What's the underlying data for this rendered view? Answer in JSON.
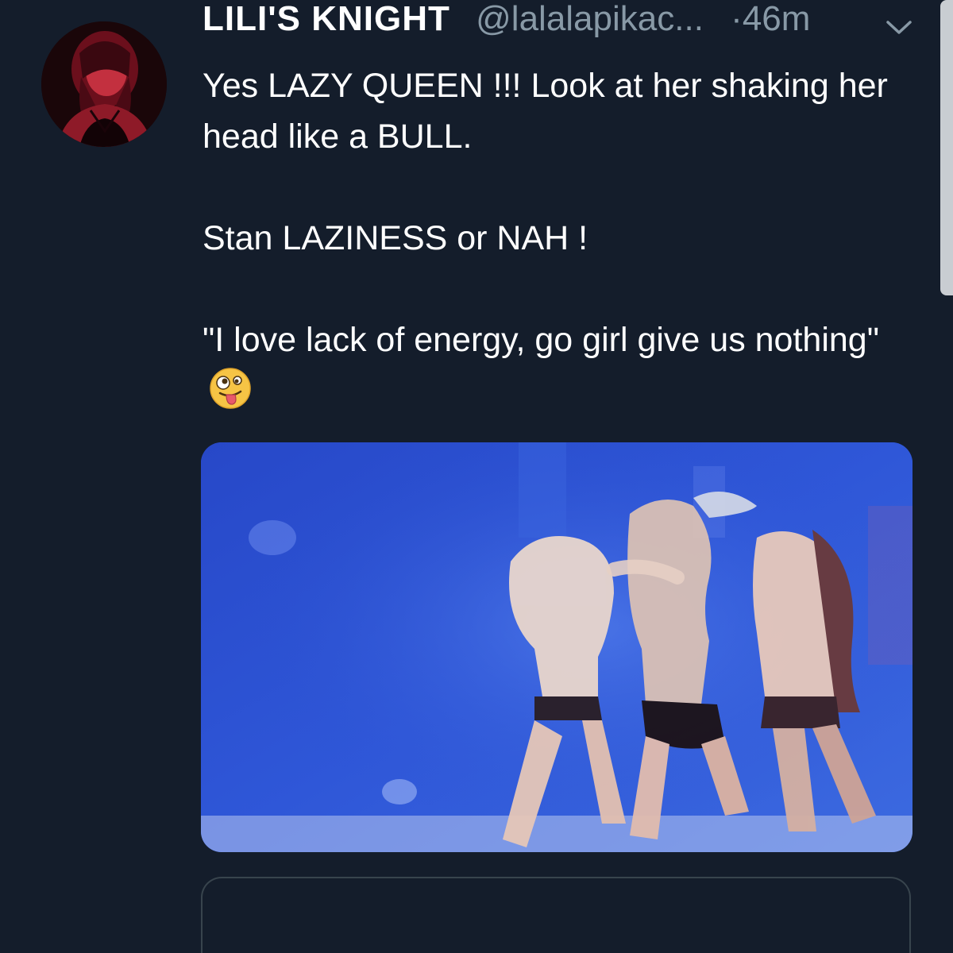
{
  "tweet": {
    "author": {
      "display_name": "LILI'S KNIGHT",
      "handle": "@lalalapikac...",
      "avatar_icon": "avatar-photo"
    },
    "separator": "·",
    "timestamp": "46m",
    "menu_icon": "chevron-down-icon",
    "text": "Yes LAZY QUEEN !!! Look at her shaking her head like a BULL.\n\nStan LAZINESS or NAH !\n\n\"I love lack of energy, go girl give us nothing\"",
    "emoji": "zany-face-emoji",
    "media": {
      "type": "video",
      "icon": "video-thumbnail"
    },
    "quoted_card": {}
  },
  "colors": {
    "background": "#141d2b",
    "text_primary": "#ffffff",
    "text_secondary": "#8899a6",
    "border": "#38444d",
    "scrollbar": "#c9cdd2"
  }
}
